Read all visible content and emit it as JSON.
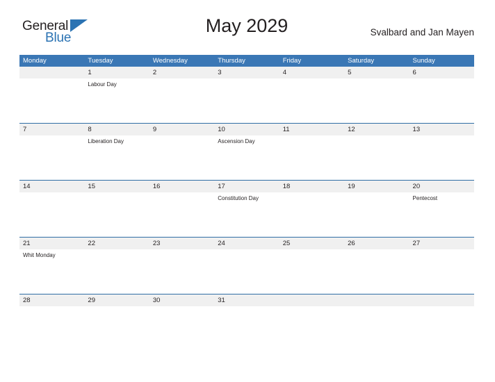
{
  "brand": {
    "name_part1": "General",
    "name_part2": "Blue",
    "triangle_icon": "triangle-icon",
    "color_dark": "#231f20",
    "color_blue": "#2b73b3"
  },
  "header": {
    "title": "May 2029",
    "region": "Svalbard and Jan Mayen"
  },
  "theme": {
    "header_bar": "#3a77b5",
    "row_rule": "#2e6da4",
    "number_strip": "#f0f0f0",
    "page_background": "#ffffff",
    "text": "#231f20"
  },
  "calendar": {
    "weekday_headers": [
      "Monday",
      "Tuesday",
      "Wednesday",
      "Thursday",
      "Friday",
      "Saturday",
      "Sunday"
    ],
    "weeks": [
      {
        "days": [
          {
            "number": "",
            "events": []
          },
          {
            "number": "1",
            "events": [
              "Labour Day"
            ]
          },
          {
            "number": "2",
            "events": []
          },
          {
            "number": "3",
            "events": []
          },
          {
            "number": "4",
            "events": []
          },
          {
            "number": "5",
            "events": []
          },
          {
            "number": "6",
            "events": []
          }
        ]
      },
      {
        "days": [
          {
            "number": "7",
            "events": []
          },
          {
            "number": "8",
            "events": [
              "Liberation Day"
            ]
          },
          {
            "number": "9",
            "events": []
          },
          {
            "number": "10",
            "events": [
              "Ascension Day"
            ]
          },
          {
            "number": "11",
            "events": []
          },
          {
            "number": "12",
            "events": []
          },
          {
            "number": "13",
            "events": []
          }
        ]
      },
      {
        "days": [
          {
            "number": "14",
            "events": []
          },
          {
            "number": "15",
            "events": []
          },
          {
            "number": "16",
            "events": []
          },
          {
            "number": "17",
            "events": [
              "Constitution Day"
            ]
          },
          {
            "number": "18",
            "events": []
          },
          {
            "number": "19",
            "events": []
          },
          {
            "number": "20",
            "events": [
              "Pentecost"
            ]
          }
        ]
      },
      {
        "days": [
          {
            "number": "21",
            "events": [
              "Whit Monday"
            ]
          },
          {
            "number": "22",
            "events": []
          },
          {
            "number": "23",
            "events": []
          },
          {
            "number": "24",
            "events": []
          },
          {
            "number": "25",
            "events": []
          },
          {
            "number": "26",
            "events": []
          },
          {
            "number": "27",
            "events": []
          }
        ]
      },
      {
        "days": [
          {
            "number": "28",
            "events": []
          },
          {
            "number": "29",
            "events": []
          },
          {
            "number": "30",
            "events": []
          },
          {
            "number": "31",
            "events": []
          },
          {
            "number": "",
            "events": []
          },
          {
            "number": "",
            "events": []
          },
          {
            "number": "",
            "events": []
          }
        ]
      }
    ]
  }
}
